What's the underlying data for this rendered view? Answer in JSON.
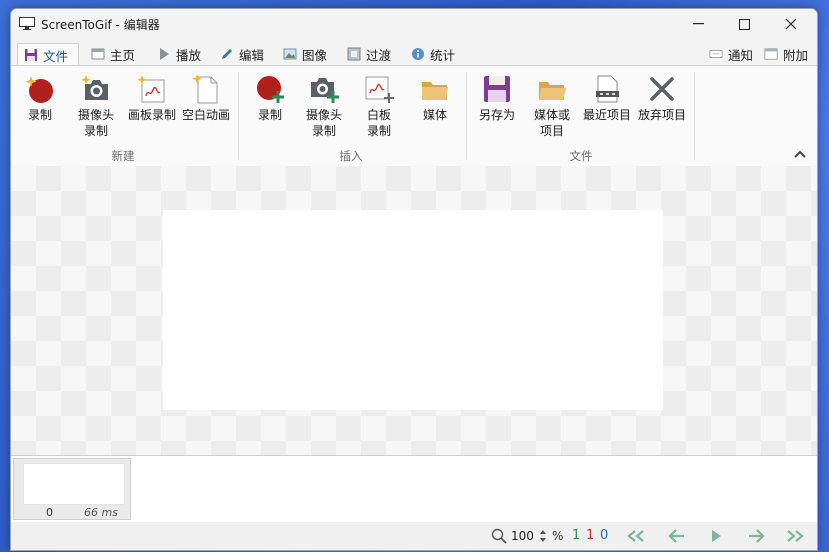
{
  "window": {
    "title": "ScreenToGif - 编辑器"
  },
  "tabs": [
    {
      "label": "文件",
      "icon": "save-icon"
    },
    {
      "label": "主页",
      "icon": "home-icon"
    },
    {
      "label": "播放",
      "icon": "play-icon"
    },
    {
      "label": "编辑",
      "icon": "pencil-icon"
    },
    {
      "label": "图像",
      "icon": "image-icon"
    },
    {
      "label": "过渡",
      "icon": "transition-icon"
    },
    {
      "label": "统计",
      "icon": "info-icon"
    }
  ],
  "extras": {
    "notify": "通知",
    "extra": "附加"
  },
  "ribbon": {
    "new": {
      "label": "新建",
      "record": "录制",
      "webcam_l1": "摄像头",
      "webcam_l2": "录制",
      "board": "画板录制",
      "blank": "空白动画"
    },
    "insert": {
      "label": "插入",
      "record": "录制",
      "webcam_l1": "摄像头",
      "webcam_l2": "录制",
      "board_l1": "白板",
      "board_l2": "录制",
      "media": "媒体"
    },
    "file": {
      "label": "文件",
      "save_as": "另存为",
      "media_l1": "媒体或",
      "media_l2": "项目",
      "recent": "最近项目",
      "discard": "放弃项目"
    }
  },
  "frames": [
    {
      "number": "0",
      "delay": "66 ms"
    }
  ],
  "status": {
    "zoom": "100",
    "zoom_unit": "%",
    "count_total": "1",
    "count_selected": "1",
    "count_current": "0"
  },
  "colors": {
    "accent": "#1d4fa0",
    "record_red": "#b0201c",
    "save_purple": "#7b3e95",
    "folder": "#e8b86a",
    "nav_green": "#6aa88c"
  }
}
